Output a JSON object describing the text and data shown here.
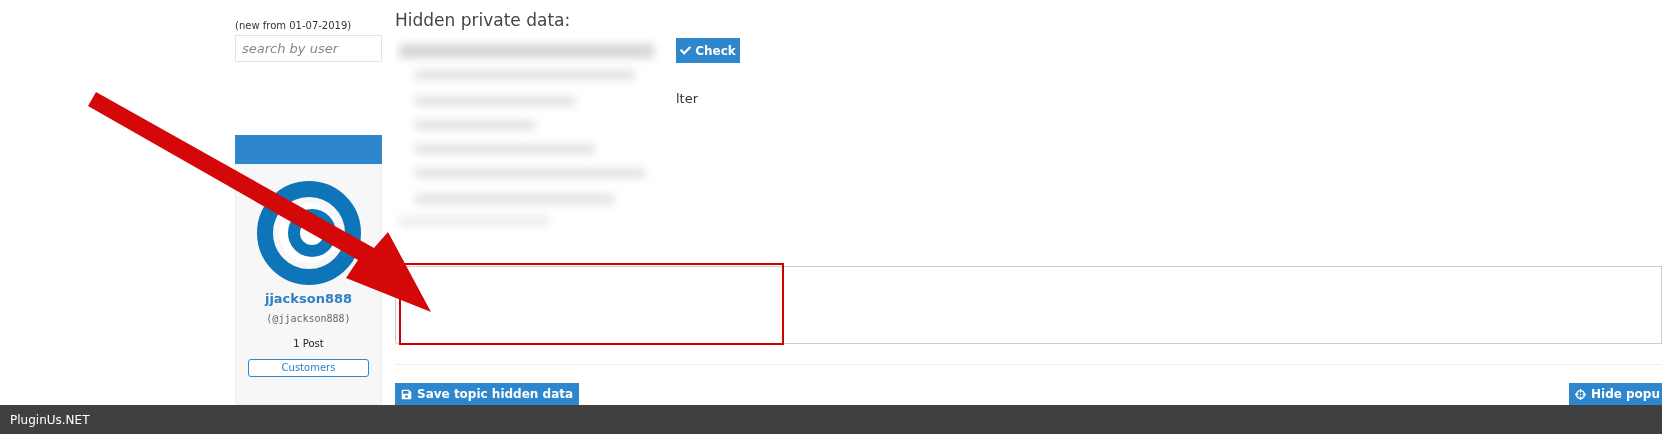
{
  "sidebar": {
    "note": "(new from 01-07-2019)",
    "search": {
      "placeholder": "search by user"
    },
    "user": {
      "name": "jjackson888",
      "handle": "(@jjackson888)",
      "posts": "1 Post",
      "group": "Customers"
    }
  },
  "popup": {
    "title": "Hidden private data:",
    "check_button": "Check",
    "partial_label": "lter",
    "save_button": "Save topic hidden data",
    "hide_button": "Hide popu"
  },
  "status_bar": {
    "text": "PluginUs.NET"
  }
}
